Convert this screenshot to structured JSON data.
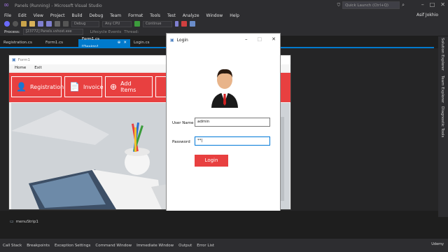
{
  "window": {
    "title": "Panels (Running) - Microsoft Visual Studio",
    "quick_launch": "Quick Launch (Ctrl+Q)",
    "user": "Asif Jokhio"
  },
  "menu": [
    "File",
    "Edit",
    "View",
    "Project",
    "Build",
    "Debug",
    "Team",
    "Format",
    "Tools",
    "Test",
    "Analyze",
    "Window",
    "Help"
  ],
  "toolbar": {
    "config": "Debug",
    "platform": "Any CPU",
    "continue": "Continue"
  },
  "process": {
    "label": "Process:",
    "value": "[23772] Panels.vshost.exe",
    "lifecycle": "Lifecycle Events",
    "thread": "Thread:"
  },
  "tabs": [
    {
      "label": "Registration.cs",
      "active": false
    },
    {
      "label": "Form1.cs",
      "active": false
    },
    {
      "label": "Form1.cs [Design]",
      "active": true
    },
    {
      "label": "Login.cs",
      "active": false
    }
  ],
  "side_panels": [
    "Solution Explorer",
    "Team Explorer",
    "Diagnostic Tools"
  ],
  "form1": {
    "title": "Form1",
    "menu": [
      "Home",
      "Exit"
    ],
    "buttons": [
      "Registration",
      "Invoice",
      "Add Items"
    ],
    "accent": "#e84040"
  },
  "login": {
    "title": "Login",
    "username_label": "User Name",
    "username_value": "admin",
    "password_label": "Password",
    "password_value": "**|",
    "button": "Login",
    "accent": "#e84040"
  },
  "tray": {
    "item": "menuStrip1"
  },
  "bottom_tabs": [
    "Call Stack",
    "Breakpoints",
    "Exception Settings",
    "Command Window",
    "Immediate Window",
    "Output",
    "Error List"
  ],
  "watermark": "Udemy"
}
